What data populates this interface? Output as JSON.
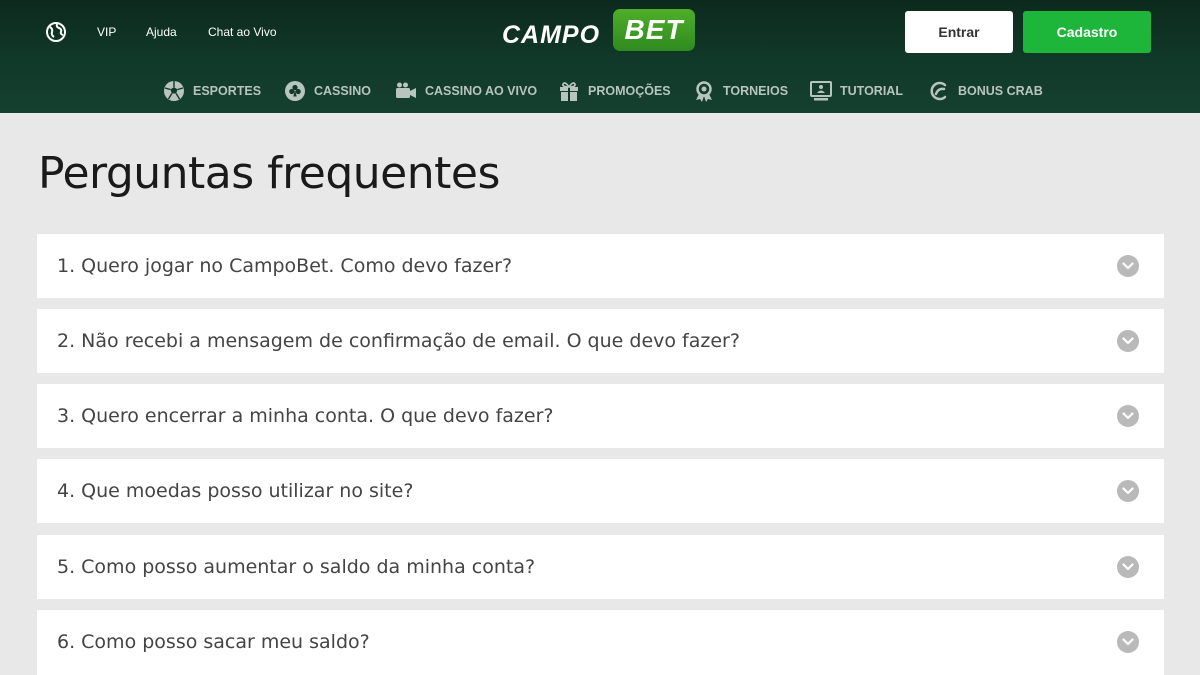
{
  "header": {
    "top_links": [
      "VIP",
      "Ajuda",
      "Chat ao Vivo"
    ],
    "logo": {
      "part1": "CAMPO",
      "part2": "BET"
    },
    "login_label": "Entrar",
    "register_label": "Cadastro"
  },
  "nav": {
    "items": [
      {
        "label": "ESPORTES",
        "icon": "soccer-ball-icon"
      },
      {
        "label": "CASSINO",
        "icon": "club-icon"
      },
      {
        "label": "CASSINO AO VIVO",
        "icon": "video-camera-icon"
      },
      {
        "label": "PROMOÇÕES",
        "icon": "gift-icon"
      },
      {
        "label": "TORNEIOS",
        "icon": "medal-icon"
      },
      {
        "label": "TUTORIAL",
        "icon": "monitor-icon"
      },
      {
        "label": "BONUS CRAB",
        "icon": "crab-claw-icon"
      }
    ]
  },
  "page": {
    "title": "Perguntas frequentes"
  },
  "faq": [
    "1. Quero jogar no CampoBet. Como devo fazer?",
    "2. Não recebi a mensagem de confirmação de email. O que devo fazer?",
    "3. Quero encerrar a minha conta. O que devo fazer?",
    "4. Que moedas posso utilizar no site?",
    "5. Como posso aumentar o saldo da minha conta?",
    "6. Como posso sacar meu saldo?"
  ],
  "colors": {
    "header_bg": "#11392a",
    "brand_green": "#1db53a",
    "page_bg": "#e8e8e8"
  }
}
